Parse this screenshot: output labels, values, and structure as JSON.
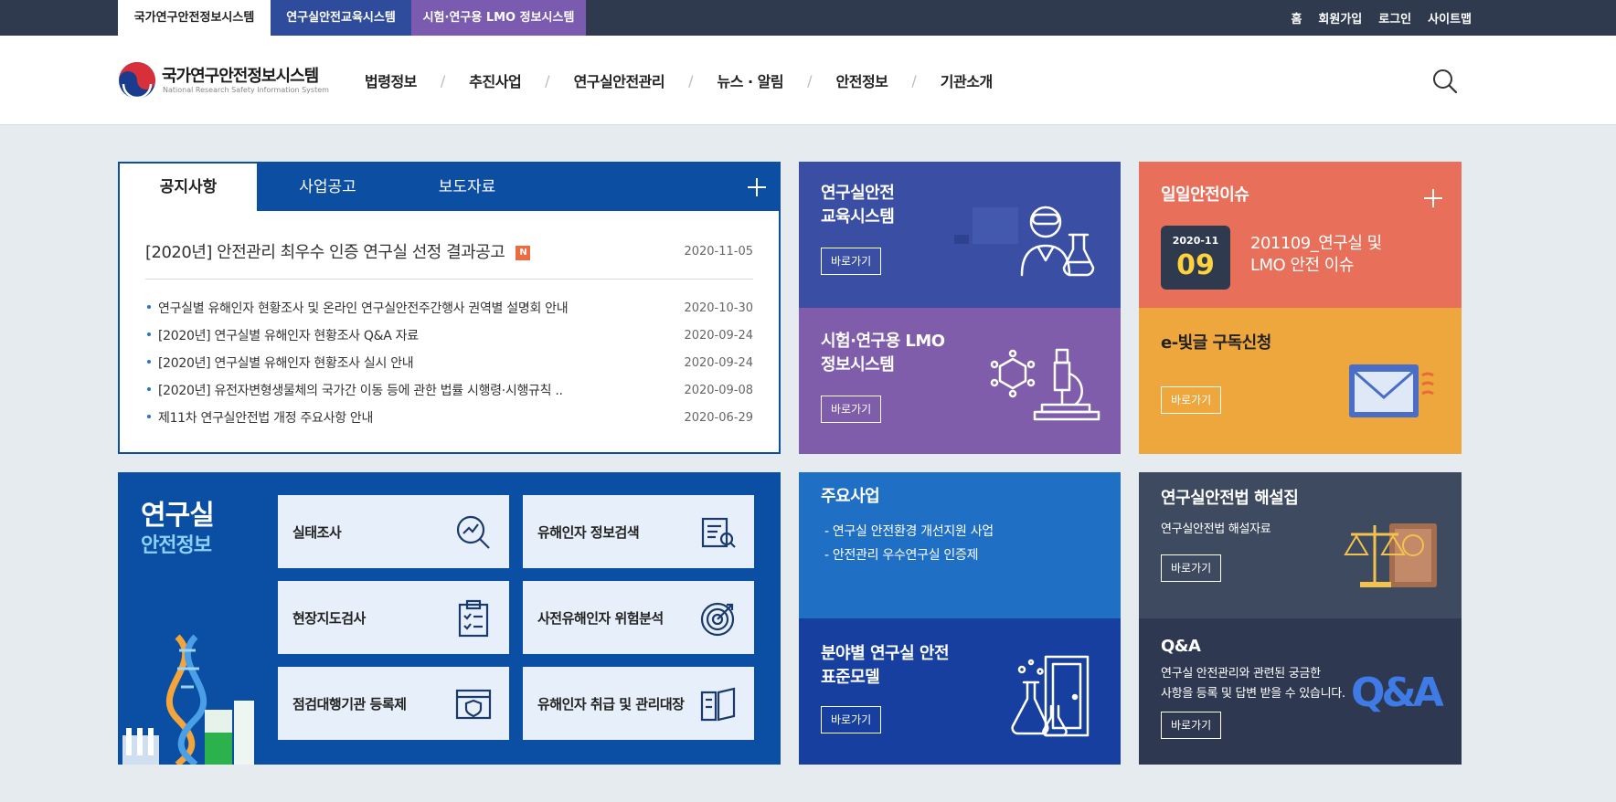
{
  "topbar": {
    "tabs": [
      "국가연구안전정보시스템",
      "연구실안전교육시스템",
      "시험·연구용 LMO 정보시스템"
    ],
    "links": [
      "홈",
      "회원가입",
      "로그인",
      "사이트맵"
    ]
  },
  "header": {
    "logo_title": "국가연구안전정보시스템",
    "logo_subtitle": "National Research Safety Information System",
    "nav": [
      "법령정보",
      "추진사업",
      "연구실안전관리",
      "뉴스 · 알림",
      "안전정보",
      "기관소개"
    ]
  },
  "notice": {
    "tabs": [
      "공지사항",
      "사업공고",
      "보도자료"
    ],
    "featured": {
      "title": "[2020년] 안전관리 최우수 인증 연구실 선정 결과공고",
      "badge": "N",
      "date": "2020-11-05"
    },
    "items": [
      {
        "title": "연구실별 유해인자 현황조사 및 온라인 연구실안전주간행사 권역별 설명회 안내",
        "date": "2020-10-30"
      },
      {
        "title": "[2020년] 연구실별 유해인자 현황조사 Q&A 자료",
        "date": "2020-09-24"
      },
      {
        "title": "[2020년] 연구실별 유해인자 현황조사 실시 안내",
        "date": "2020-09-24"
      },
      {
        "title": "[2020년] 유전자변형생물체의 국가간 이동 등에 관한 법률 시행령·시행규칙 ..",
        "date": "2020-09-08"
      },
      {
        "title": "제11차 연구실안전법 개정 주요사항 안내",
        "date": "2020-06-29"
      }
    ]
  },
  "tiles": {
    "edu": {
      "title_line1": "연구실안전",
      "title_line2": "교육시스템",
      "button": "바로가기"
    },
    "lmo": {
      "title_line1": "시험·연구용 LMO",
      "title_line2": "정보시스템",
      "button": "바로가기"
    },
    "daily": {
      "title": "일일안전이슈",
      "month": "2020-11",
      "day": "09",
      "text_line1": "201109_연구실 및",
      "text_line2": "LMO 안전 이슈"
    },
    "newsletter": {
      "title": "e-빛글 구독신청",
      "button": "바로가기"
    },
    "major": {
      "title": "주요사업",
      "items": [
        "- 연구실 안전환경 개선지원 사업",
        "- 안전관리 우수연구실 인증제"
      ]
    },
    "standard": {
      "title_line1": "분야별 연구실 안전",
      "title_line2": "표준모델",
      "button": "바로가기"
    },
    "law": {
      "title": "연구실안전법 해설집",
      "desc": "연구실안전법 해설자료",
      "button": "바로가기"
    },
    "qna": {
      "title": "Q&A",
      "desc_line1": "연구실 안전관리와 관련된 궁금한",
      "desc_line2": "사항을 등록 및 답변 받을 수 있습니다.",
      "button": "바로가기",
      "art_text": "Q&A"
    }
  },
  "lab": {
    "title_line1": "연구실",
    "title_line2": "안전정보",
    "items": [
      "실태조사",
      "유해인자 정보검색",
      "현장지도검사",
      "사전유해인자 위험분석",
      "점검대행기관 등록제",
      "유해인자 취급 및 관리대장"
    ]
  },
  "colors": {
    "topbar": "#2f3a4f",
    "primary_blue": "#0c4ea2",
    "edu_tile": "#3a4fa3",
    "lmo_tile": "#7f5dab",
    "daily_tile": "#e8705a",
    "newsletter_tile": "#eea73d",
    "major_tile": "#1f6fc4",
    "standard_tile": "#173f9f",
    "law_tile": "#3e4a60",
    "qna_tile": "#2e3850"
  }
}
